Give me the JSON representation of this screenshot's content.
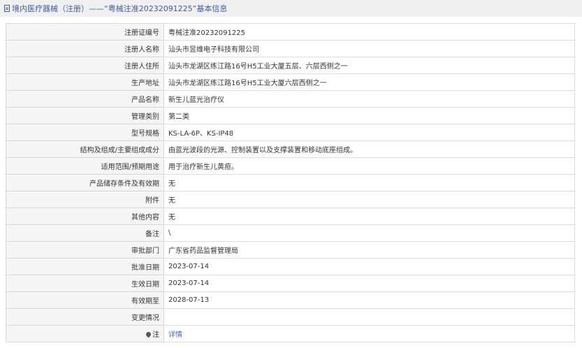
{
  "header": {
    "title": "境内医疗器械（注册）——“粤械注准20232091225”基本信息"
  },
  "rows": [
    {
      "label": "注册证编号",
      "value": "粤械注准20232091225"
    },
    {
      "label": "注册人名称",
      "value": "汕头市昱维电子科技有限公司"
    },
    {
      "label": "注册人住所",
      "value": "汕头市龙湖区练江路16号H5工业大厦五层、六层西侧之一"
    },
    {
      "label": "生产地址",
      "value": "汕头市龙湖区练江路16号H5工业大厦六层西侧之一"
    },
    {
      "label": "产品名称",
      "value": "新生儿蓝光治疗仪"
    },
    {
      "label": "管理类别",
      "value": "第二类"
    },
    {
      "label": "型号规格",
      "value": "KS-LA-6P、KS-IP48"
    },
    {
      "label": "结构及组成/主要组成成分",
      "value": "由蓝光波段的光源、控制装置以及支撑装置和移动底座组成。"
    },
    {
      "label": "适用范围/预期用途",
      "value": "用于治疗新生儿黄疸。"
    },
    {
      "label": "产品储存条件及有效期",
      "value": "无"
    },
    {
      "label": "附件",
      "value": "无"
    },
    {
      "label": "其他内容",
      "value": "无"
    },
    {
      "label": "备注",
      "value": "\\"
    },
    {
      "label": "审批部门",
      "value": "广东省药品监督管理局"
    },
    {
      "label": "批准日期",
      "value": "2023-07-14"
    },
    {
      "label": "生效日期",
      "value": "2023-07-14"
    },
    {
      "label": "有效期至",
      "value": "2028-07-13"
    },
    {
      "label": "变更情况",
      "value": ""
    }
  ],
  "note_row": {
    "label": "注",
    "link_text": "详情",
    "icon": "pin-icon"
  }
}
